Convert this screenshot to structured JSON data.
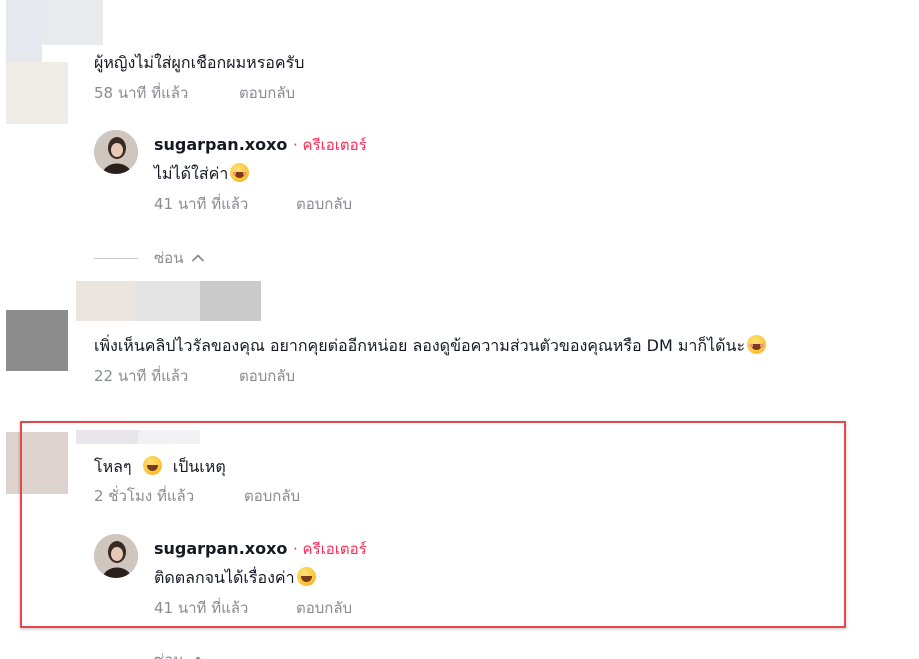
{
  "comments": [
    {
      "text": "ผู้หญิงไม่ใส่ผูกเชือกผมหรอครับ",
      "time": "58 นาที ที่แล้ว",
      "reply_label": "ตอบกลับ",
      "replies": [
        {
          "username": "sugarpan.xoxo",
          "creator_badge": "· ครีเอเตอร์",
          "text": "ไม่ได้ใส่ค่า",
          "emoji": "rofl-emoji",
          "time": "41 นาที ที่แล้ว",
          "reply_label": "ตอบกลับ"
        }
      ],
      "hide_label": "ซ่อน"
    },
    {
      "text": "เพิ่งเห็นคลิปไวรัลของคุณ อยากคุยต่ออีกหน่อย ลองดูข้อความส่วนตัวของคุณหรือ DM มาก็ได้นะ",
      "emoji": "smiling-blush-emoji",
      "time": "22 นาที ที่แล้ว",
      "reply_label": "ตอบกลับ"
    },
    {
      "text": "โหลๆ",
      "emoji": "laughing-tears-emoji",
      "text_after": "เป็นเหตุ",
      "time": "2 ชั่วโมง ที่แล้ว",
      "reply_label": "ตอบกลับ",
      "replies": [
        {
          "username": "sugarpan.xoxo",
          "creator_badge": "· ครีเอเตอร์",
          "text": "ติดตลกจนได้เรื่องค่า",
          "emoji": "laughing-tears-emoji",
          "time": "41 นาที ที่แล้ว",
          "reply_label": "ตอบกลับ"
        }
      ],
      "hide_label": "ซ่อน"
    }
  ],
  "colors": {
    "creator": "#fe2c55",
    "meta": "#8a8b91",
    "highlight": "#e5474b"
  }
}
